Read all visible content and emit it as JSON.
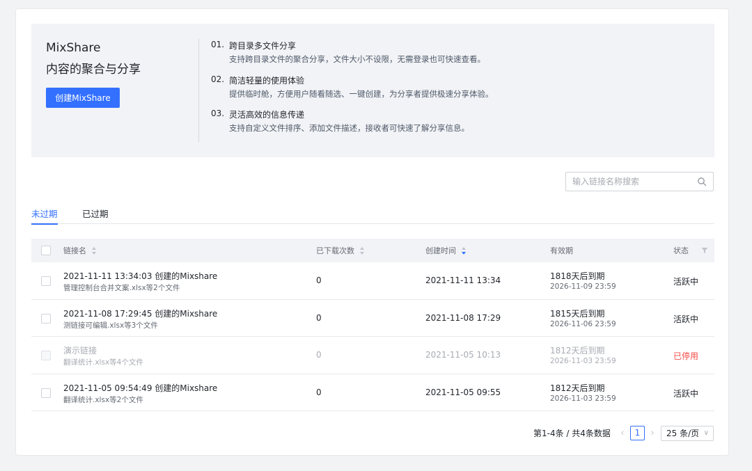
{
  "banner": {
    "brand_name": "MixShare",
    "tagline": "内容的聚合与分享",
    "create_button": "创建MixShare",
    "features": [
      {
        "num": "01.",
        "title": "跨目录多文件分享",
        "desc": "支持跨目录文件的聚合分享，文件大小不设限，无需登录也可快速查看。"
      },
      {
        "num": "02.",
        "title": "简洁轻量的使用体验",
        "desc": "提供临时舱，方便用户随看随选、一键创建，为分享者提供极速分享体验。"
      },
      {
        "num": "03.",
        "title": "灵活高效的信息传递",
        "desc": "支持自定义文件排序、添加文件描述，接收者可快速了解分享信息。"
      }
    ]
  },
  "search": {
    "placeholder": "输入链接名称搜索",
    "value": ""
  },
  "tabs": [
    {
      "label": "未过期",
      "active": true
    },
    {
      "label": "已过期",
      "active": false
    }
  ],
  "table": {
    "headers": {
      "name": "链接名",
      "downloads": "已下载次数",
      "created": "创建时间",
      "expiry": "有效期",
      "status": "状态"
    },
    "rows": [
      {
        "name": "2021-11-11 13:34:03 创建的Mixshare",
        "files": "管理控制台合并文案.xlsx等2个文件",
        "downloads": "0",
        "created": "2021-11-11 13:34",
        "expire_in": "1818天后到期",
        "expire_at": "2026-11-09 23:59",
        "status": "活跃中",
        "disabled": false
      },
      {
        "name": "2021-11-08 17:29:45 创建的Mixshare",
        "files": "测链接可编辑.xlsx等3个文件",
        "downloads": "0",
        "created": "2021-11-08 17:29",
        "expire_in": "1815天后到期",
        "expire_at": "2026-11-06 23:59",
        "status": "活跃中",
        "disabled": false
      },
      {
        "name": "演示链接",
        "files": "翻译统计.xlsx等4个文件",
        "downloads": "0",
        "created": "2021-11-05 10:13",
        "expire_in": "1812天后到期",
        "expire_at": "2026-11-03 23:59",
        "status": "已停用",
        "disabled": true
      },
      {
        "name": "2021-11-05 09:54:49 创建的Mixshare",
        "files": "翻译统计.xlsx等2个文件",
        "downloads": "0",
        "created": "2021-11-05 09:55",
        "expire_in": "1812天后到期",
        "expire_at": "2026-11-03 23:59",
        "status": "活跃中",
        "disabled": false
      }
    ]
  },
  "pagination": {
    "summary": "第1-4条 / 共4条数据",
    "current_page": "1",
    "page_size": "25 条/页"
  },
  "colors": {
    "accent": "#3370ff",
    "disabled_status": "#f54a45",
    "banner_bg": "#f2f3f6"
  },
  "icons": {
    "search": "search-icon",
    "filter": "filter-icon",
    "sort": "sort-icon",
    "prev": "chevron-left-icon",
    "next": "chevron-right-icon",
    "dropdown": "chevron-down-icon"
  }
}
